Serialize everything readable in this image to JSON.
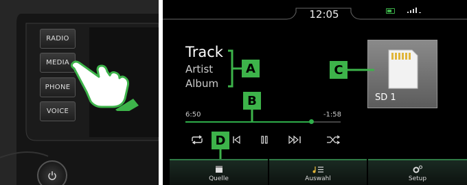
{
  "hardware": {
    "buttons": [
      "RADIO",
      "MEDIA",
      "PHONE",
      "VOICE"
    ],
    "knob_icon": "power-icon"
  },
  "status_bar": {
    "time": "12:05",
    "icons": [
      "battery-icon",
      "signal-icon"
    ]
  },
  "track": {
    "title": "Track",
    "artist": "Artist",
    "album": "Album"
  },
  "progress": {
    "elapsed": "6:50",
    "remaining": "-1:58",
    "fraction": 0.81
  },
  "source": {
    "name": "SD 1",
    "icon": "sd-card-icon"
  },
  "controls": [
    "repeat-icon",
    "previous-icon",
    "pause-icon",
    "next-icon",
    "shuffle-icon"
  ],
  "tabs": [
    {
      "label": "Quelle",
      "icon": "source-icon"
    },
    {
      "label": "Auswahl",
      "icon": "music-list-icon"
    },
    {
      "label": "Setup",
      "icon": "settings-gear-icon"
    }
  ],
  "callouts": {
    "a": "A",
    "b": "B",
    "c": "C",
    "d": "D"
  },
  "colors": {
    "accent_green": "#3db34a",
    "screen_bg": "#000000",
    "progress_green": "#2fae4a"
  }
}
